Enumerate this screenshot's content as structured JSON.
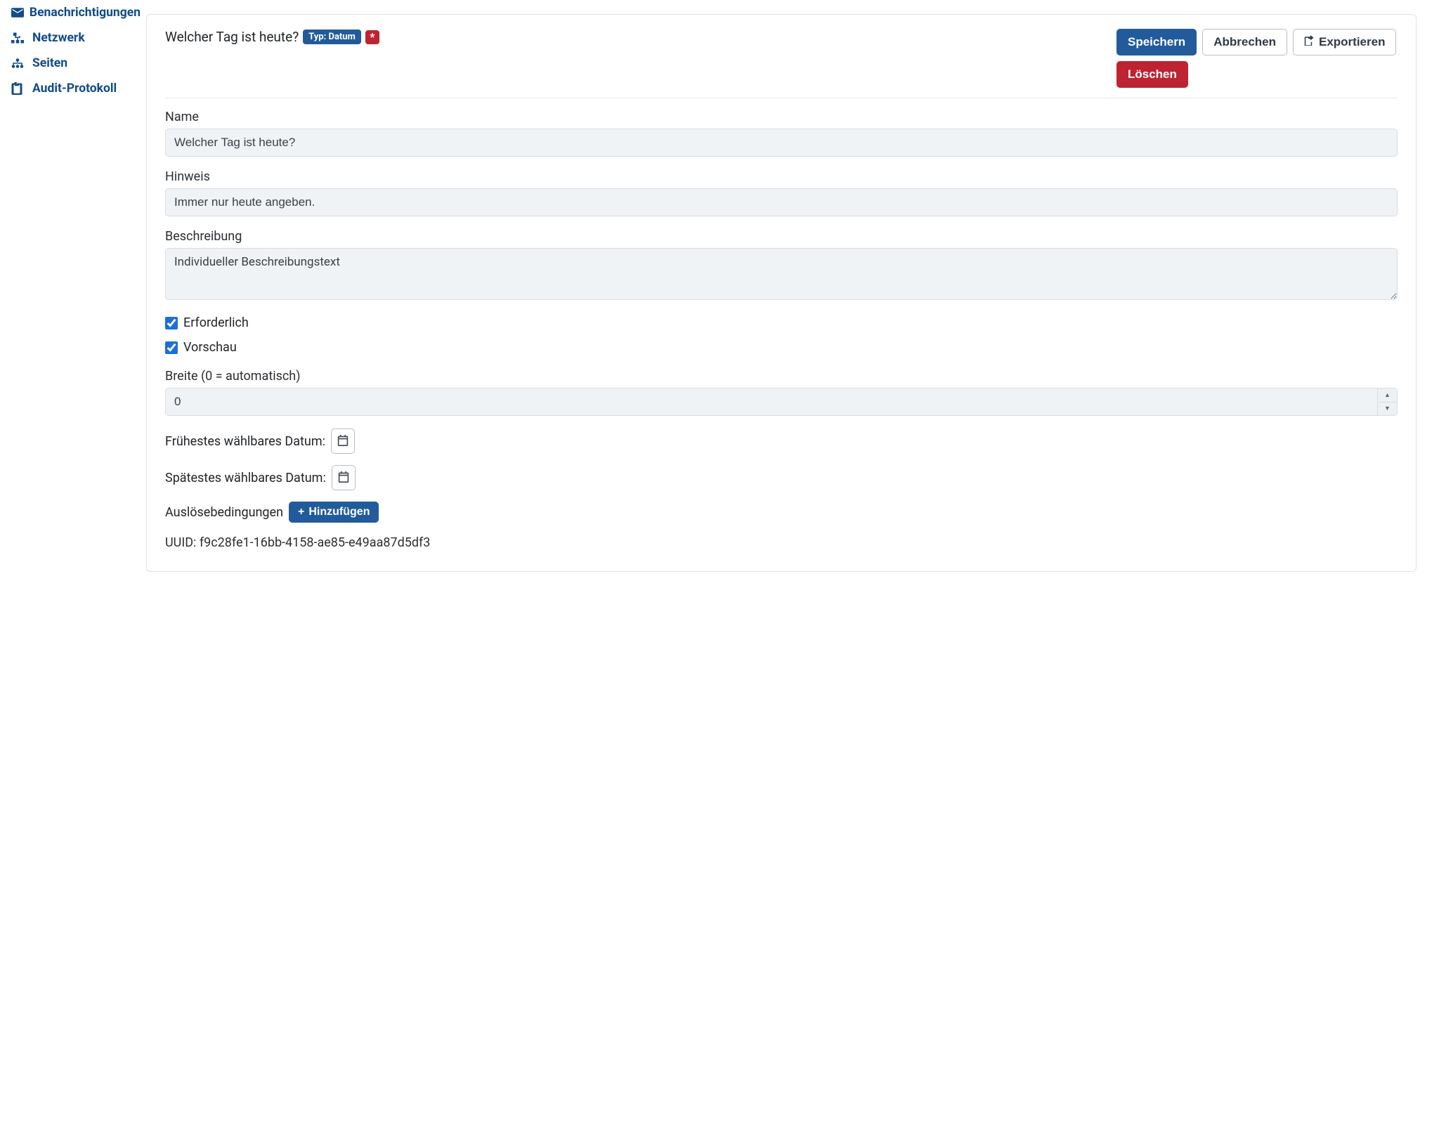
{
  "sidebar": {
    "items": [
      {
        "label": "Benachrichtigungen",
        "icon": "envelope-icon"
      },
      {
        "label": "Netzwerk",
        "icon": "network-icon"
      },
      {
        "label": "Seiten",
        "icon": "sitemap-icon"
      },
      {
        "label": "Audit-Protokoll",
        "icon": "clipboard-icon"
      }
    ]
  },
  "header": {
    "title": "Welcher Tag ist heute?",
    "type_badge": "Typ: Datum",
    "required_mark": "*"
  },
  "actions": {
    "save": "Speichern",
    "cancel": "Abbrechen",
    "export": "Exportieren",
    "delete": "Löschen"
  },
  "form": {
    "name_label": "Name",
    "name_value": "Welcher Tag ist heute?",
    "hint_label": "Hinweis",
    "hint_value": "Immer nur heute angeben.",
    "desc_label": "Beschreibung",
    "desc_value": "Individueller Beschreibungstext",
    "required_label": "Erforderlich",
    "required_checked": true,
    "preview_label": "Vorschau",
    "preview_checked": true,
    "width_label": "Breite (0 = automatisch)",
    "width_value": "0",
    "earliest_label": "Frühestes wählbares Datum:",
    "latest_label": "Spätestes wählbares Datum:",
    "triggers_label": "Auslösebedingungen",
    "add_button": "Hinzufügen",
    "uuid_label": "UUID: ",
    "uuid_value": "f9c28fe1-16bb-4158-ae85-e49aa87d5df3"
  }
}
